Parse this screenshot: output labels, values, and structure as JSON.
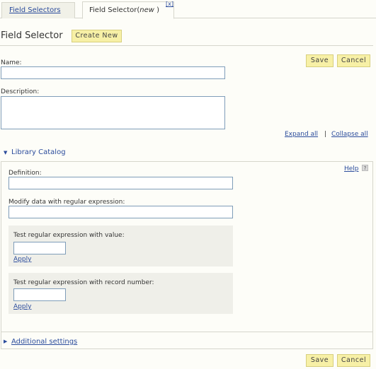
{
  "tabs": [
    {
      "label": "Field Selectors"
    },
    {
      "label": "Field Selector(",
      "suffix_italic": "new",
      "suffix_end": ")",
      "close": "[x]"
    }
  ],
  "page_title": "Field Selector",
  "create_new_label": "Create New",
  "save_label": "Save",
  "cancel_label": "Cancel",
  "form": {
    "name_label": "Name:",
    "name_value": "",
    "description_label": "Description:",
    "description_value": ""
  },
  "expand_all": "Expand all",
  "collapse_all": "Collapse all",
  "link_separator": "|",
  "library": {
    "title": "Library Catalog",
    "help": "Help",
    "help_icon_glyph": "?",
    "definition_label": "Definition:",
    "definition_value": "",
    "regex_label": "Modify data with regular expression:",
    "regex_value": "",
    "test_value_label": "Test regular expression with value:",
    "test_value_value": "",
    "test_record_label": "Test regular expression with record number:",
    "test_record_value": "",
    "apply_label": "Apply"
  },
  "additional_settings": "Additional settings",
  "icons": {
    "expanded": "triangle-down-icon",
    "collapsed": "triangle-right-icon",
    "help": "help-icon"
  },
  "colors": {
    "link": "#2b4c9c",
    "button_bg": "#f7f0a6",
    "panel_bg": "#efefe9",
    "input_border": "#7f9db9"
  }
}
